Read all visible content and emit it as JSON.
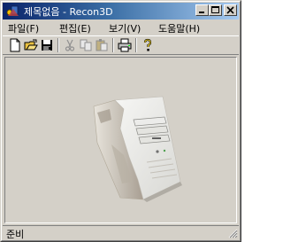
{
  "window": {
    "title": "제목없음 - Recon3D"
  },
  "menu": {
    "items": [
      {
        "label": "파일(F)"
      },
      {
        "label": "편집(E)"
      },
      {
        "label": "보기(V)"
      },
      {
        "label": "도움말(H)"
      }
    ]
  },
  "toolbar": {
    "buttons": [
      {
        "icon": "new-file-icon"
      },
      {
        "icon": "open-folder-icon"
      },
      {
        "icon": "save-disk-icon"
      },
      {
        "icon": "cut-icon"
      },
      {
        "icon": "copy-icon"
      },
      {
        "icon": "paste-icon"
      },
      {
        "icon": "print-icon"
      },
      {
        "icon": "help-icon"
      }
    ]
  },
  "viewport": {
    "subject": "3D computer tower model"
  },
  "status": {
    "text": "준비"
  },
  "colors": {
    "title_active_start": "#0a246a",
    "title_active_end": "#a6caf0",
    "face": "#d4d0c8"
  }
}
